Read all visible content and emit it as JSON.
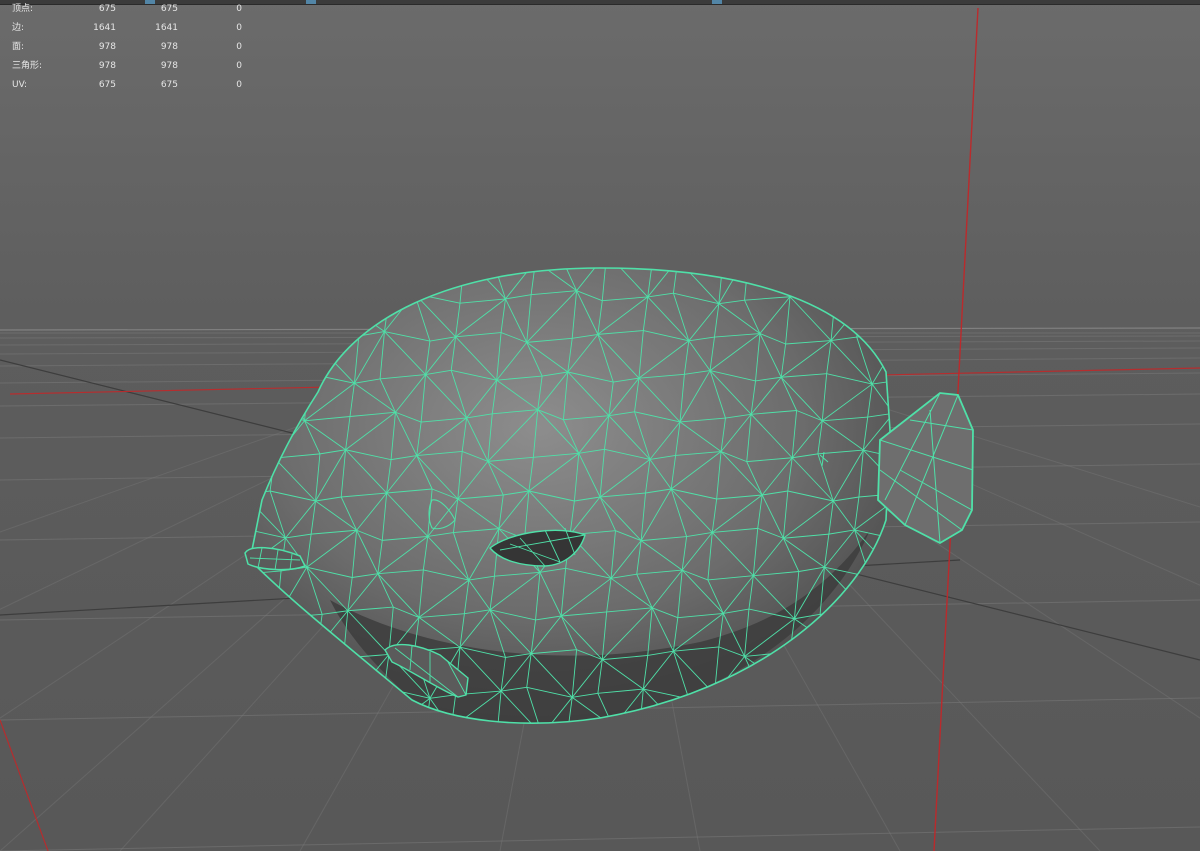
{
  "viewport": {
    "background": "#5d5d5d",
    "wireframe_color": "#4fe0a8",
    "axis_color": "#c0282a",
    "grid_color": "#7a7a7a"
  },
  "hud": {
    "rows": [
      {
        "label": "顶点:",
        "v1": "675",
        "v2": "675",
        "v3": "0"
      },
      {
        "label": "边:",
        "v1": "1641",
        "v2": "1641",
        "v3": "0"
      },
      {
        "label": "面:",
        "v1": "978",
        "v2": "978",
        "v3": "0"
      },
      {
        "label": "三角形:",
        "v1": "978",
        "v2": "978",
        "v3": "0"
      },
      {
        "label": "UV:",
        "v1": "675",
        "v2": "675",
        "v3": "0"
      }
    ]
  },
  "model": {
    "name_icon": "fish-mesh-icon"
  }
}
